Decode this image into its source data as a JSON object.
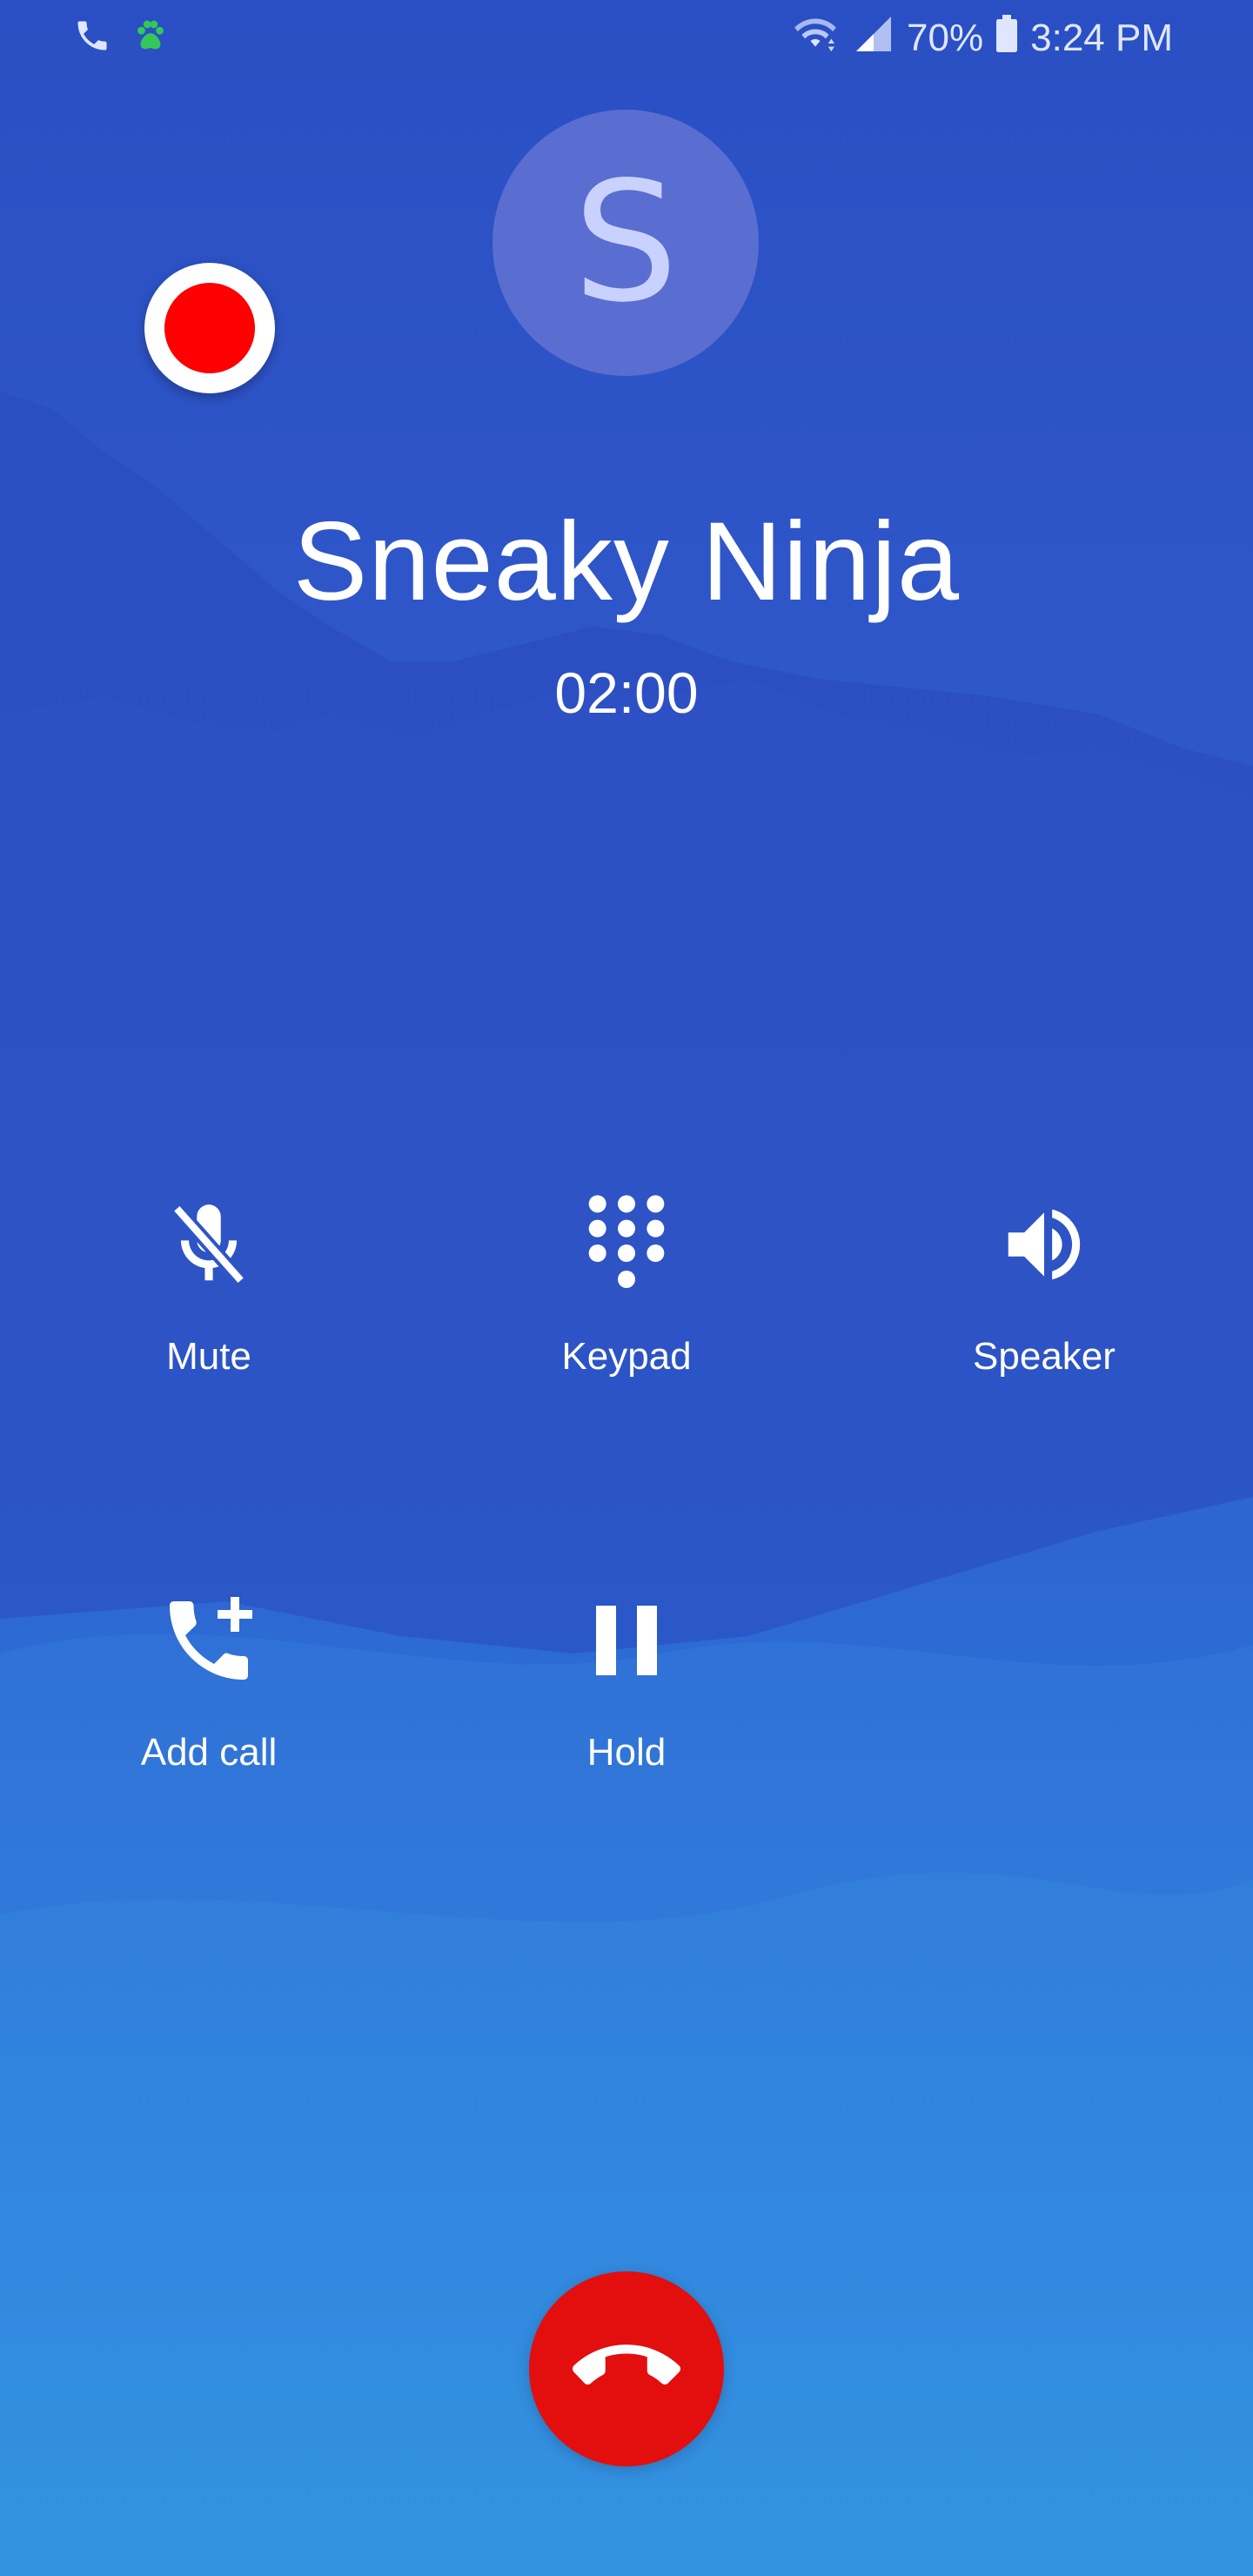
{
  "status_bar": {
    "battery": "70%",
    "time": "3:24 PM",
    "left_icons": [
      "phone-icon",
      "paw-icon"
    ],
    "right_icons": [
      "wifi-icon",
      "signal-icon",
      "battery-icon"
    ]
  },
  "contact": {
    "initial": "S",
    "name": "Sneaky Ninja",
    "duration": "02:00"
  },
  "controls": {
    "mute": {
      "label": "Mute",
      "icon": "mic-off-icon"
    },
    "keypad": {
      "label": "Keypad",
      "icon": "dialpad-icon"
    },
    "speaker": {
      "label": "Speaker",
      "icon": "speaker-icon"
    },
    "add_call": {
      "label": "Add call",
      "icon": "add-call-icon"
    },
    "hold": {
      "label": "Hold",
      "icon": "pause-icon"
    }
  },
  "colors": {
    "end_call": "#e30e0e",
    "record": "#ff0000",
    "paw": "#34c759"
  }
}
